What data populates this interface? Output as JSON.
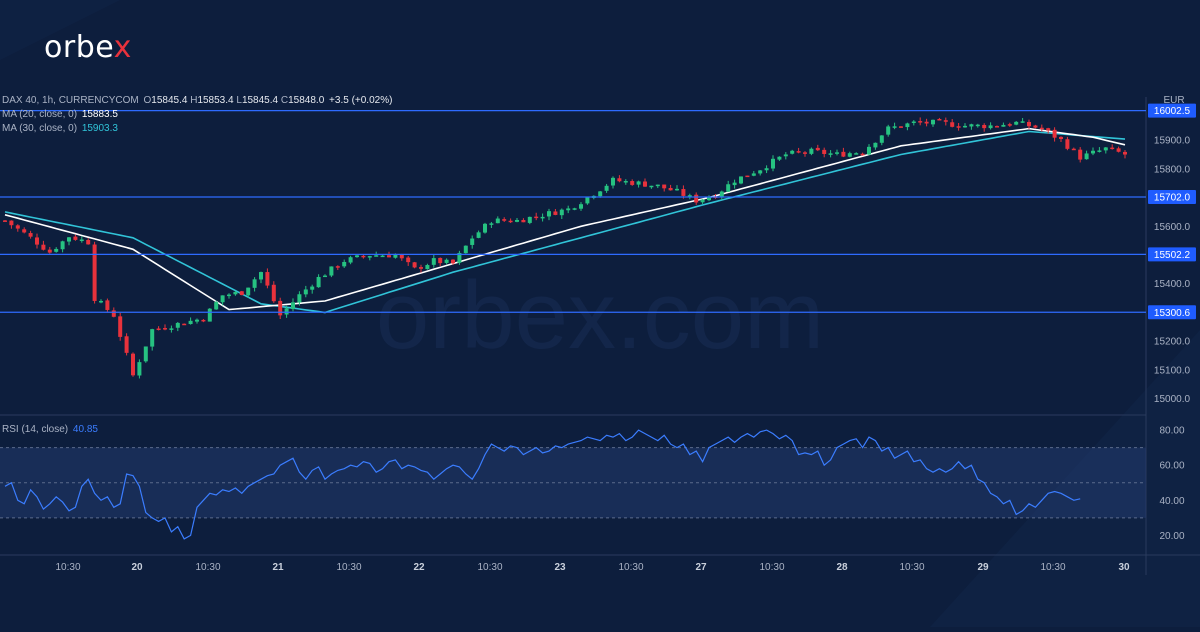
{
  "brand": {
    "logo_prefix": "orbe",
    "logo_x": "x",
    "watermark": "orbex.com"
  },
  "legend": {
    "symbol": "DAX 40, 1h, CURRENCYCOM",
    "o_label": "O",
    "o": "15845.4",
    "h_label": "H",
    "h": "15853.4",
    "l_label": "L",
    "l": "15845.4",
    "c_label": "C",
    "c": "15848.0",
    "change": "+3.5 (+0.02%)",
    "ma20_label": "MA (20, close, 0)",
    "ma20_value": "15883.5",
    "ma30_label": "MA (30, close, 0)",
    "ma30_value": "15903.3",
    "rsi_label": "RSI (14, close)",
    "rsi_value": "40.85"
  },
  "currency": "EUR",
  "colors": {
    "background": "#0d1e3d",
    "up": "#26c281",
    "down": "#e8323c",
    "ma20": "#ffffff",
    "ma30": "#31c4d8",
    "rsi": "#3b7dff",
    "levels": "#2e6bff"
  },
  "chart_data": [
    {
      "type": "candlestick",
      "title": "DAX 40, 1h, CURRENCYCOM",
      "ylim": [
        14950,
        16050
      ],
      "y_ticks": [
        "16000.0",
        "15900.0",
        "15800.0",
        "15700.0",
        "15600.0",
        "15500.0",
        "15400.0",
        "15300.0",
        "15200.0",
        "15100.0",
        "15000.0"
      ],
      "x_ticks": [
        "10:30",
        "20",
        "10:30",
        "21",
        "10:30",
        "22",
        "10:30",
        "23",
        "10:30",
        "27",
        "10:30",
        "28",
        "10:30",
        "29",
        "10:30",
        "30"
      ],
      "levels": [
        {
          "label": "16002.5",
          "value": 16002.5
        },
        {
          "label": "15702.0",
          "value": 15702.0
        },
        {
          "label": "15502.2",
          "value": 15502.2
        },
        {
          "label": "15300.6",
          "value": 15300.6
        }
      ],
      "anchors": [
        [
          0,
          15620
        ],
        [
          4,
          15560
        ],
        [
          7,
          15510
        ],
        [
          10,
          15565
        ],
        [
          13,
          15545
        ],
        [
          14,
          15350
        ],
        [
          17,
          15290
        ],
        [
          20,
          15080
        ],
        [
          23,
          15240
        ],
        [
          27,
          15260
        ],
        [
          31,
          15280
        ],
        [
          34,
          15360
        ],
        [
          37,
          15370
        ],
        [
          40,
          15440
        ],
        [
          43,
          15290
        ],
        [
          46,
          15360
        ],
        [
          49,
          15420
        ],
        [
          53,
          15480
        ],
        [
          57,
          15500
        ],
        [
          61,
          15500
        ],
        [
          64,
          15450
        ],
        [
          67,
          15480
        ],
        [
          70,
          15470
        ],
        [
          73,
          15560
        ],
        [
          76,
          15620
        ],
        [
          80,
          15620
        ],
        [
          84,
          15640
        ],
        [
          88,
          15660
        ],
        [
          91,
          15700
        ],
        [
          95,
          15760
        ],
        [
          99,
          15750
        ],
        [
          102,
          15740
        ],
        [
          105,
          15720
        ],
        [
          108,
          15690
        ],
        [
          111,
          15710
        ],
        [
          114,
          15760
        ],
        [
          118,
          15800
        ],
        [
          122,
          15850
        ],
        [
          126,
          15860
        ],
        [
          130,
          15850
        ],
        [
          134,
          15860
        ],
        [
          138,
          15940
        ],
        [
          142,
          15960
        ],
        [
          146,
          15960
        ],
        [
          150,
          15950
        ],
        [
          154,
          15950
        ],
        [
          158,
          15960
        ],
        [
          162,
          15940
        ],
        [
          165,
          15900
        ],
        [
          168,
          15840
        ],
        [
          172,
          15870
        ],
        [
          175,
          15850
        ]
      ],
      "ma20": [
        [
          0,
          15640
        ],
        [
          20,
          15520
        ],
        [
          35,
          15310
        ],
        [
          50,
          15340
        ],
        [
          70,
          15470
        ],
        [
          90,
          15600
        ],
        [
          110,
          15700
        ],
        [
          140,
          15880
        ],
        [
          160,
          15940
        ],
        [
          170,
          15910
        ],
        [
          175,
          15883.5
        ]
      ],
      "ma30": [
        [
          0,
          15650
        ],
        [
          20,
          15560
        ],
        [
          40,
          15330
        ],
        [
          50,
          15300
        ],
        [
          70,
          15440
        ],
        [
          90,
          15560
        ],
        [
          110,
          15680
        ],
        [
          140,
          15850
        ],
        [
          160,
          15930
        ],
        [
          175,
          15903.3
        ]
      ]
    },
    {
      "type": "line",
      "title": "RSI (14, close)",
      "ylim": [
        10,
        88
      ],
      "y_ticks": [
        "80.00",
        "60.00",
        "40.00",
        "20.00"
      ],
      "band": [
        30,
        70
      ],
      "midline": 50,
      "values": [
        48,
        50,
        40,
        38,
        46,
        42,
        35,
        38,
        42,
        39,
        34,
        36,
        48,
        52,
        44,
        40,
        42,
        36,
        38,
        55,
        54,
        48,
        33,
        30,
        28,
        30,
        22,
        25,
        18,
        20,
        36,
        40,
        44,
        43,
        46,
        45,
        47,
        44,
        48,
        50,
        52,
        54,
        55,
        60,
        62,
        64,
        56,
        52,
        57,
        59,
        52,
        55,
        57,
        58,
        60,
        59,
        62,
        61,
        56,
        58,
        62,
        63,
        58,
        60,
        59,
        57,
        56,
        52,
        55,
        58,
        60,
        59,
        55,
        52,
        58,
        66,
        72,
        70,
        68,
        71,
        70,
        66,
        68,
        70,
        67,
        68,
        71,
        70,
        72,
        73,
        74,
        76,
        75,
        74,
        77,
        76,
        78,
        74,
        76,
        80,
        78,
        76,
        74,
        77,
        72,
        70,
        72,
        66,
        68,
        62,
        70,
        72,
        74,
        76,
        73,
        76,
        78,
        76,
        79,
        80,
        78,
        75,
        77,
        74,
        66,
        67,
        66,
        68,
        60,
        63,
        70,
        72,
        74,
        75,
        70,
        76,
        74,
        68,
        70,
        64,
        66,
        68,
        62,
        63,
        58,
        56,
        58,
        56,
        58,
        62,
        58,
        60,
        52,
        50,
        44,
        42,
        38,
        40,
        32,
        34,
        38,
        36,
        40,
        44,
        45,
        44,
        42,
        40,
        40.85
      ]
    }
  ]
}
